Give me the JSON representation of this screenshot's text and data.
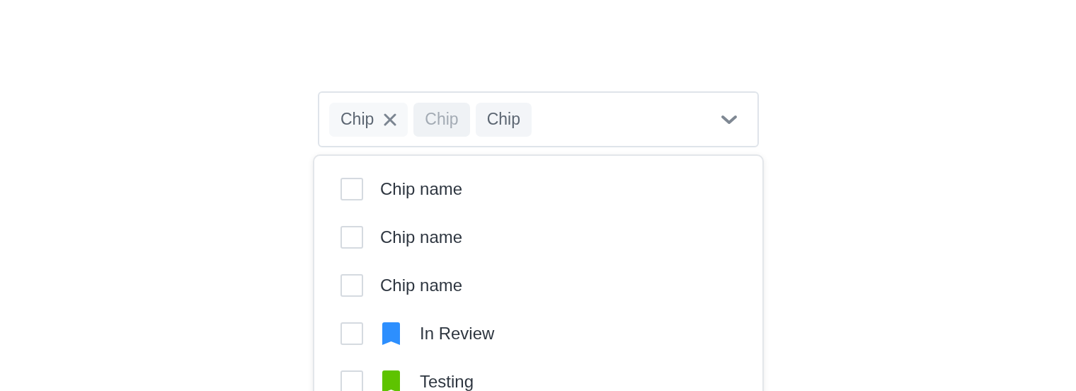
{
  "select": {
    "chips": [
      {
        "label": "Chip",
        "disabled": false,
        "removable": true
      },
      {
        "label": "Chip",
        "disabled": true,
        "removable": false
      },
      {
        "label": "Chip",
        "disabled": false,
        "removable": false
      }
    ]
  },
  "options": [
    {
      "kind": "plain",
      "label": "Chip name",
      "checked": false
    },
    {
      "kind": "plain",
      "label": "Chip name",
      "checked": false
    },
    {
      "kind": "plain",
      "label": "Chip name",
      "checked": false
    },
    {
      "kind": "status",
      "label": "In Review",
      "checked": false,
      "color": "#2d8ffe"
    },
    {
      "kind": "status",
      "label": "Testing",
      "checked": false,
      "color": "#5ec300"
    }
  ]
}
